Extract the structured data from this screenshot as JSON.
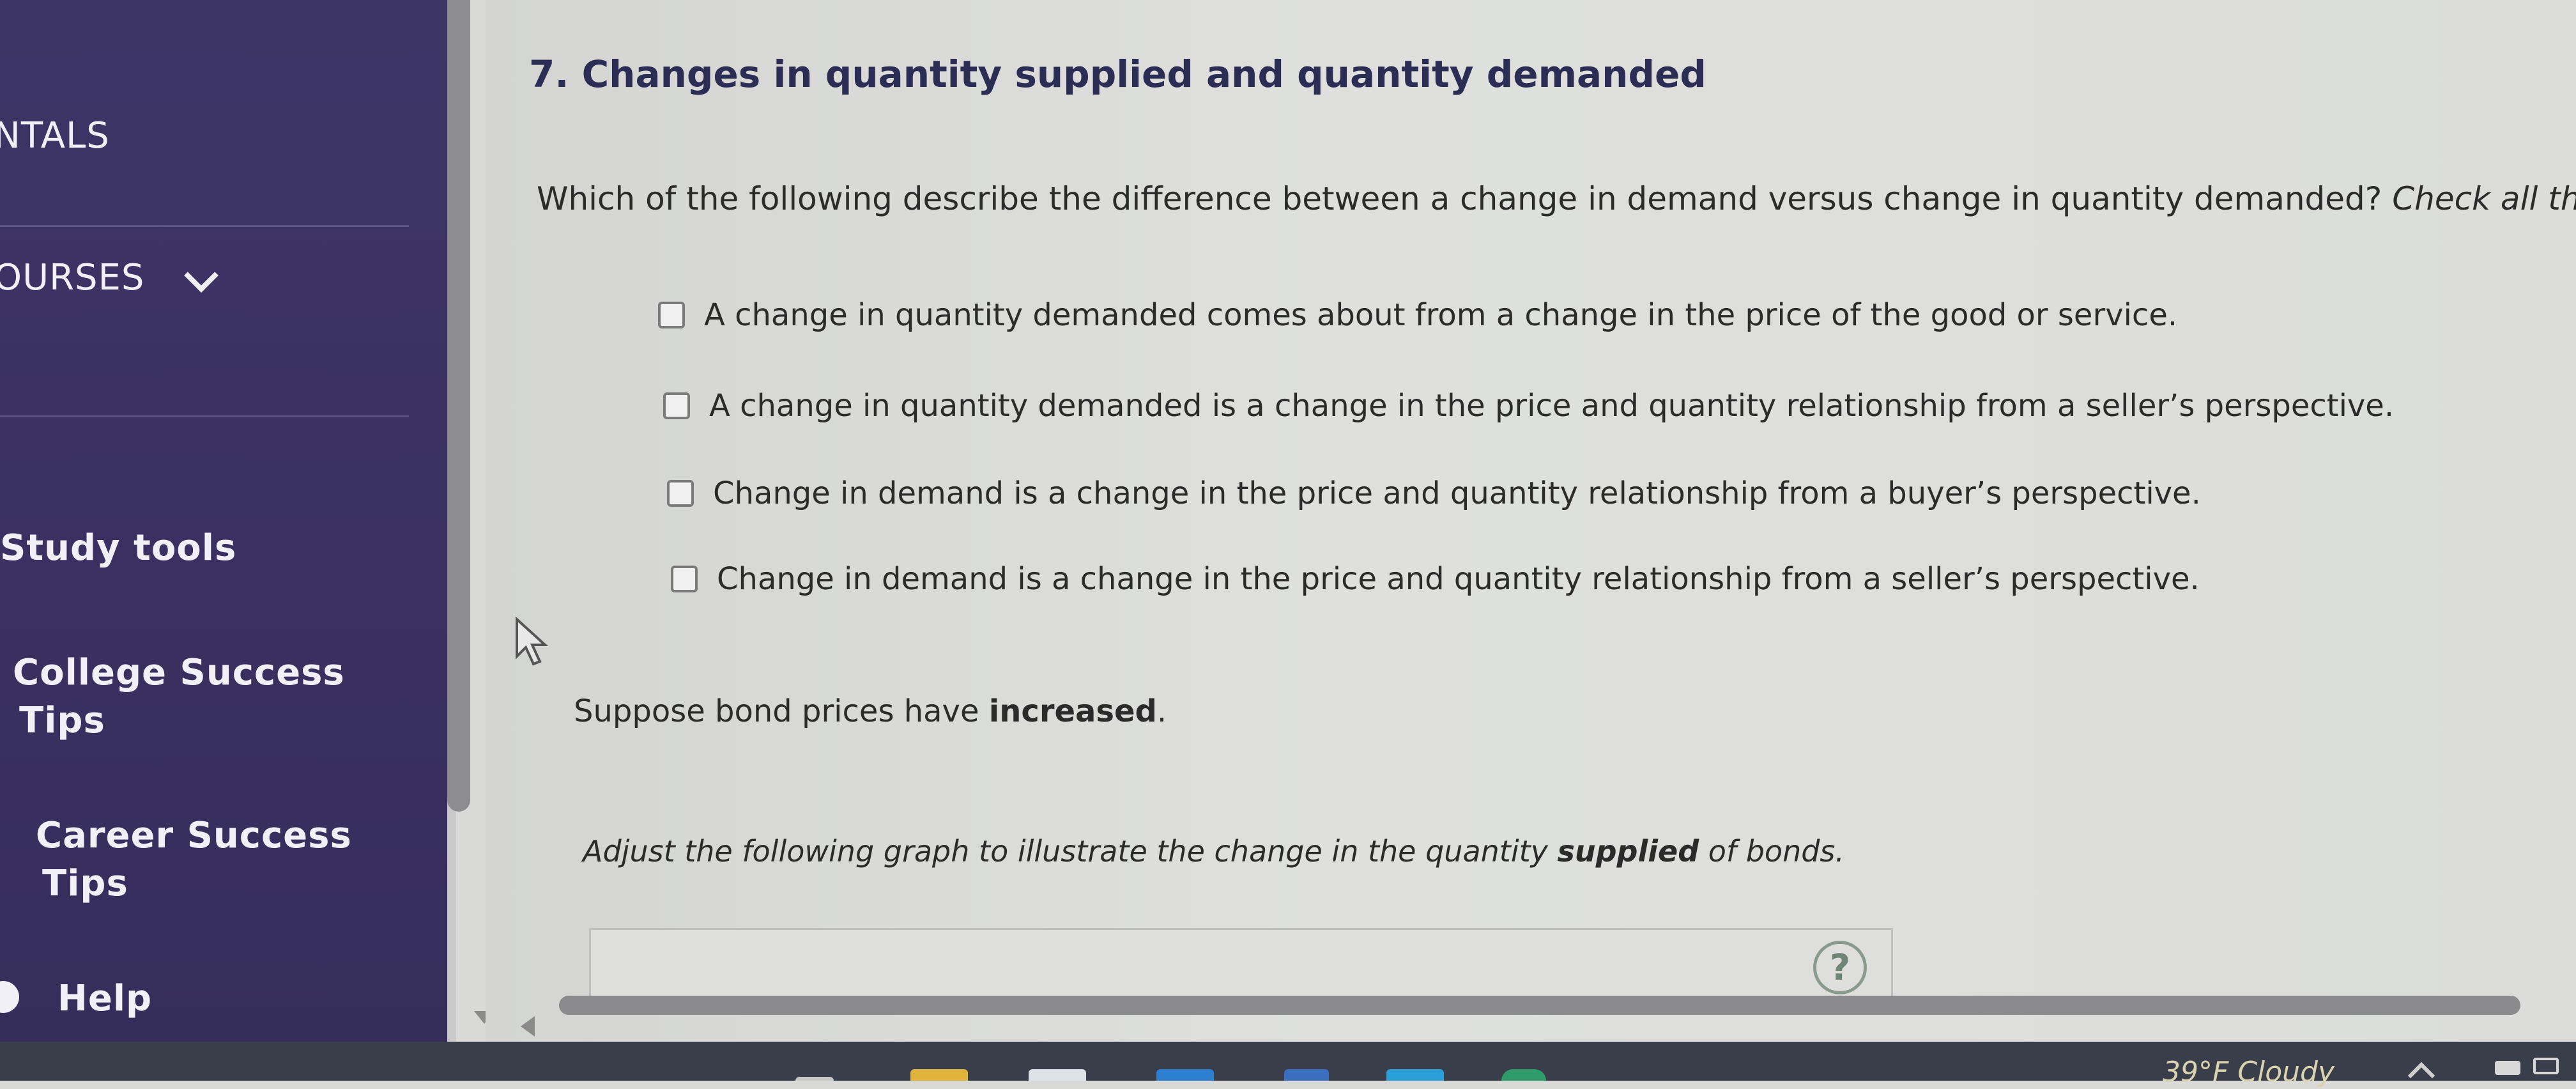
{
  "sidebar": {
    "items": [
      {
        "label": "NTALS"
      },
      {
        "label": "OURSES"
      },
      {
        "label": "Study tools"
      },
      {
        "label": "College Success"
      },
      {
        "label": "Tips"
      },
      {
        "label": "Career Success"
      },
      {
        "label": "Tips"
      },
      {
        "label": "Help"
      }
    ]
  },
  "question": {
    "title": "7. Changes in quantity supplied and quantity demanded",
    "prompt": "Which of the following describe the difference between a change in demand versus change in quantity demanded? ",
    "prompt_hint": "Check all that a",
    "options": [
      {
        "label": "A change in quantity demanded comes about from a change in the price of the good or service.",
        "checked": false
      },
      {
        "label": "A change in quantity demanded is a change in the price and quantity relationship from a seller’s perspective.",
        "checked": false
      },
      {
        "label": "Change in demand is a change in the price and quantity relationship from a buyer’s perspective.",
        "checked": false
      },
      {
        "label": "Change in demand is a change in the price and quantity relationship from a seller’s perspective.",
        "checked": false
      }
    ],
    "suppose_prefix": "Suppose bond prices have ",
    "suppose_bold": "increased",
    "suppose_suffix": ".",
    "adjust_prefix": "Adjust the following graph to illustrate the change in the quantity ",
    "adjust_bold": "supplied",
    "adjust_suffix": " of bonds.",
    "help_label": "?"
  },
  "taskbar": {
    "weather": "39°F  Cloudy"
  }
}
